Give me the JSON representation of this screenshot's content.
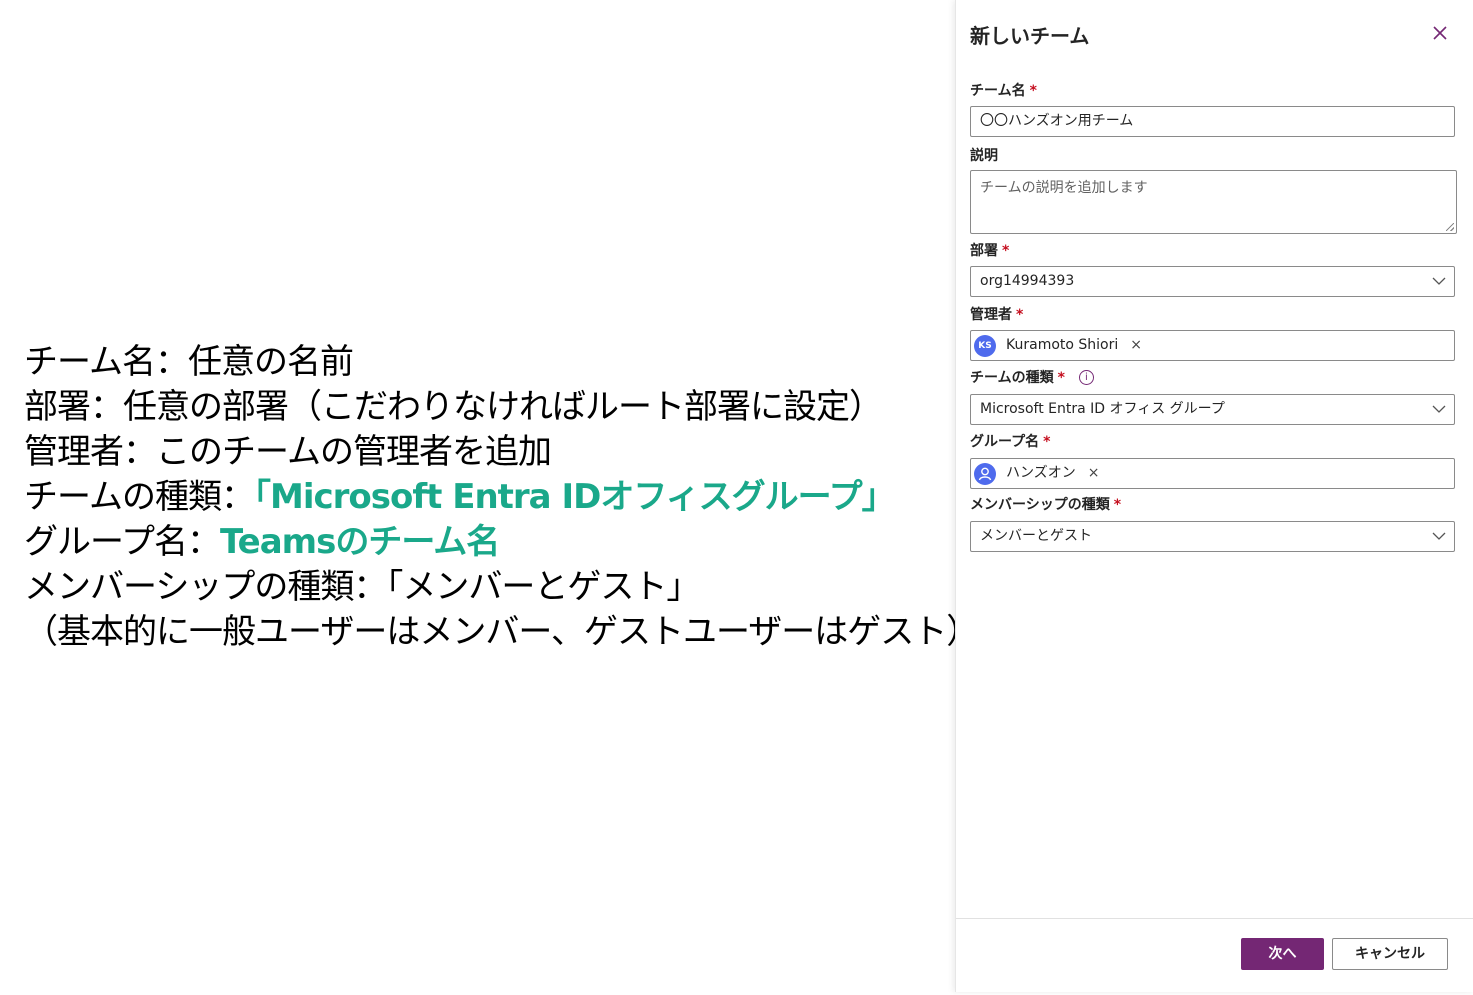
{
  "notes": {
    "line1": "チーム名：任意の名前",
    "line2": "部署：任意の部署（こだわりなければルート部署に設定）",
    "line3": "管理者：このチームの管理者を追加",
    "line4_prefix": "チームの種類：",
    "line4_highlight": "「Microsoft Entra IDオフィスグループ」",
    "line5_prefix": "グループ名：",
    "line5_highlight": "Teamsのチーム名",
    "line6": "メンバーシップの種類：「メンバーとゲスト」",
    "line7": "（基本的に一般ユーザーはメンバー、ゲストユーザーはゲスト）"
  },
  "panel": {
    "title": "新しいチーム",
    "close_icon": "close-icon",
    "team_name": {
      "label": "チーム名",
      "required": "*",
      "value": "〇〇ハンズオン用チーム"
    },
    "description": {
      "label": "説明",
      "placeholder": "チームの説明を追加します"
    },
    "department": {
      "label": "部署",
      "required": "*",
      "value": "org14994393"
    },
    "admin": {
      "label": "管理者",
      "required": "*",
      "initials": "KS",
      "name": "Kuramoto Shiori",
      "remove": "×"
    },
    "team_type": {
      "label": "チームの種類",
      "required": "*",
      "info": "i",
      "value": "Microsoft Entra ID オフィス グループ"
    },
    "group_name": {
      "label": "グループ名",
      "required": "*",
      "name": "ハンズオン",
      "remove": "×"
    },
    "membership_type": {
      "label": "メンバーシップの種類",
      "required": "*",
      "value": "メンバーとゲスト"
    },
    "buttons": {
      "next": "次へ",
      "cancel": "キャンセル"
    }
  },
  "colors": {
    "accent": "#742774",
    "highlight_text": "#1aa88a",
    "required": "#c50f1f",
    "avatar": "#4f6bed"
  }
}
